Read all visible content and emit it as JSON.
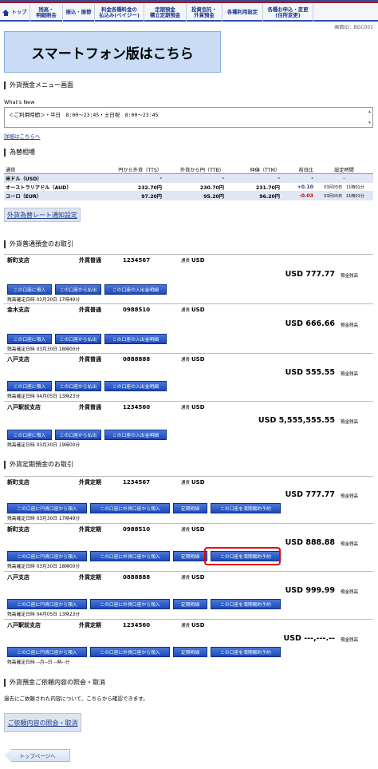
{
  "nav": [
    {
      "label": "トップ"
    },
    {
      "label": "残高・\n明細照会"
    },
    {
      "label": "振込・振替"
    },
    {
      "label": "料金各種料金の\n払込み(ペイジー)"
    },
    {
      "label": "定期預金\n積立定期預金"
    },
    {
      "label": "投資信託・\n外貨預金"
    },
    {
      "label": "各種利用設定"
    },
    {
      "label": "各種お申込・変更\n(住所変更)"
    }
  ],
  "screen_id": "画面ID：BGC001",
  "sp_banner": "スマートフォン版はこちら",
  "page_title": "外貨預金メニュー画面",
  "whats_new": {
    "label": "What's New",
    "text": "＜ご利用時間＞・平日　8:00～23:45・土日祝　8:00～23:45",
    "detail_link": "詳細はこちらへ"
  },
  "rates": {
    "title": "為替相場",
    "headers": [
      "通貨",
      "円から外貨（TTS）",
      "外貨から円（TTB）",
      "仲値（TTM）",
      "前日比",
      "設定時間"
    ],
    "rows": [
      {
        "currency": "米ドル（USD）",
        "tts": "-",
        "ttb": "-",
        "ttm": "-",
        "diff": "-",
        "time": "-"
      },
      {
        "currency": "オーストラリアドル（AUD）",
        "tts": "232.70円",
        "ttb": "230.70円",
        "ttm": "231.70円",
        "diff": "+0.10",
        "time": "03月03日　11時01分"
      },
      {
        "currency": "ユーロ（EUR）",
        "tts": "97.20円",
        "ttb": "95.20円",
        "ttm": "96.20円",
        "diff": "-0.03",
        "time": "03月03日　11時01分"
      }
    ],
    "notify_button": "外貨為替レート通知設定"
  },
  "ordinary": {
    "title": "外貨普通預金のお取引",
    "currency_label": "通貨",
    "balance_label": "預金残高",
    "buttons": [
      "この口座に預入",
      "この口座から払出",
      "この口座の入出金明細"
    ],
    "accounts": [
      {
        "branch": "新町支店",
        "type": "外貨普通",
        "number": "1234567",
        "currency": "USD",
        "balance": "USD 777.77",
        "confirmed": "残高確定日時 03月30日 17時49分"
      },
      {
        "branch": "金木支店",
        "type": "外貨普通",
        "number": "0988510",
        "currency": "USD",
        "balance": "USD 666.66",
        "confirmed": "残高確定日時 03月30日 18時00分"
      },
      {
        "branch": "八戸支店",
        "type": "外貨普通",
        "number": "0888888",
        "currency": "USD",
        "balance": "USD 555.55",
        "confirmed": "残高確定日時 04月05日 13時23分"
      },
      {
        "branch": "八戸駅前支店",
        "type": "外貨普通",
        "number": "1234560",
        "currency": "USD",
        "balance": "USD 5,555,555.55",
        "confirmed": "残高確定日時 03月30日 19時00分"
      }
    ]
  },
  "time_deposit": {
    "title": "外貨定期預金のお取引",
    "currency_label": "通貨",
    "balance_label": "預金残高",
    "buttons": [
      "この口座に円貨口座から預入",
      "この口座に外貨口座から預入",
      "定期明細",
      "この口座を満期解約予約"
    ],
    "accounts": [
      {
        "branch": "新町支店",
        "type": "外貨定期",
        "number": "1234567",
        "currency": "USD",
        "balance": "USD 777.77",
        "confirmed": "残高確定日時 03月30日 17時49分"
      },
      {
        "branch": "新町支店",
        "type": "外貨定期",
        "number": "0988510",
        "currency": "USD",
        "balance": "USD 888.88",
        "confirmed": "残高確定日時 03月30日 18時00分"
      },
      {
        "branch": "八戸支店",
        "type": "外貨定期",
        "number": "0888888",
        "currency": "USD",
        "balance": "USD 999.99",
        "confirmed": "残高確定日時 04月05日 13時23分"
      },
      {
        "branch": "八戸駅前支店",
        "type": "外貨定期",
        "number": "1234560",
        "currency": "USD",
        "balance": "USD ---,---.--",
        "confirmed": "残高確定日時 --月--日 --時--分"
      }
    ]
  },
  "inquiry": {
    "title": "外貨預金ご依頼内容の照会・取消",
    "desc": "過去にご依頼された内容について、こちらから確認できます。",
    "button": "ご依頼内容の照会・取消"
  },
  "back_button": "トップページへ",
  "colors": {
    "accent": "#1a3a8c",
    "button_blue": "#2a58c8",
    "highlight": "#e00000"
  }
}
